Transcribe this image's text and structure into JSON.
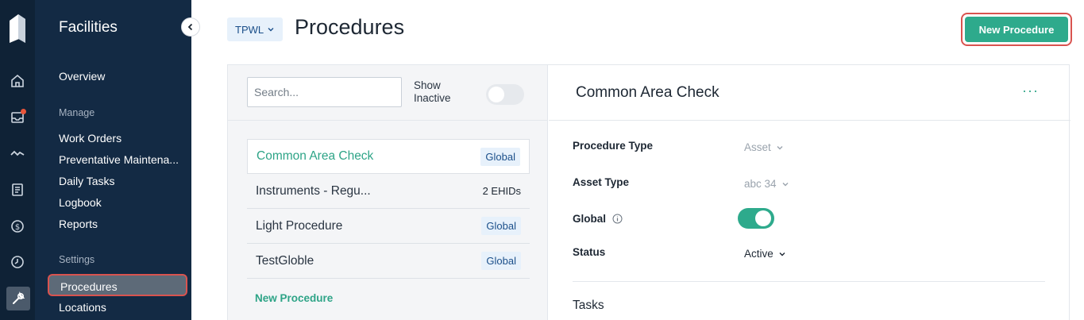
{
  "rail": {
    "icons": [
      "app-logo",
      "home-icon",
      "inbox-icon",
      "activity-icon",
      "document-icon",
      "dollar-icon",
      "clock-icon",
      "wrench-icon"
    ]
  },
  "sidebar": {
    "title": "Facilities",
    "overview": "Overview",
    "manage_heading": "Manage",
    "manage_items": [
      "Work Orders",
      "Preventative Maintena...",
      "Daily Tasks",
      "Logbook",
      "Reports"
    ],
    "settings_heading": "Settings",
    "settings_items": [
      "Procedures",
      "Locations"
    ]
  },
  "header": {
    "tenant": "TPWL",
    "title": "Procedures",
    "new_button": "New Procedure"
  },
  "list_panel": {
    "search_placeholder": "Search...",
    "show_inactive": "Show Inactive",
    "items": [
      {
        "name": "Common Area Check",
        "tag": "Global"
      },
      {
        "name": "Instruments - Regu...",
        "tag": "2 EHIDs"
      },
      {
        "name": "Light Procedure",
        "tag": "Global"
      },
      {
        "name": "TestGloble",
        "tag": "Global"
      }
    ],
    "new_link": "New Procedure"
  },
  "detail": {
    "title": "Common Area Check",
    "more": "···",
    "procedure_type_label": "Procedure Type",
    "procedure_type_value": "Asset",
    "asset_type_label": "Asset Type",
    "asset_type_value": "abc 34",
    "global_label": "Global",
    "status_label": "Status",
    "status_value": "Active",
    "tasks_heading": "Tasks"
  },
  "colors": {
    "accent": "#2eaa8c",
    "sidebar_bg": "#132a44",
    "rail_bg": "#0f2236",
    "highlight": "#d9534f"
  }
}
